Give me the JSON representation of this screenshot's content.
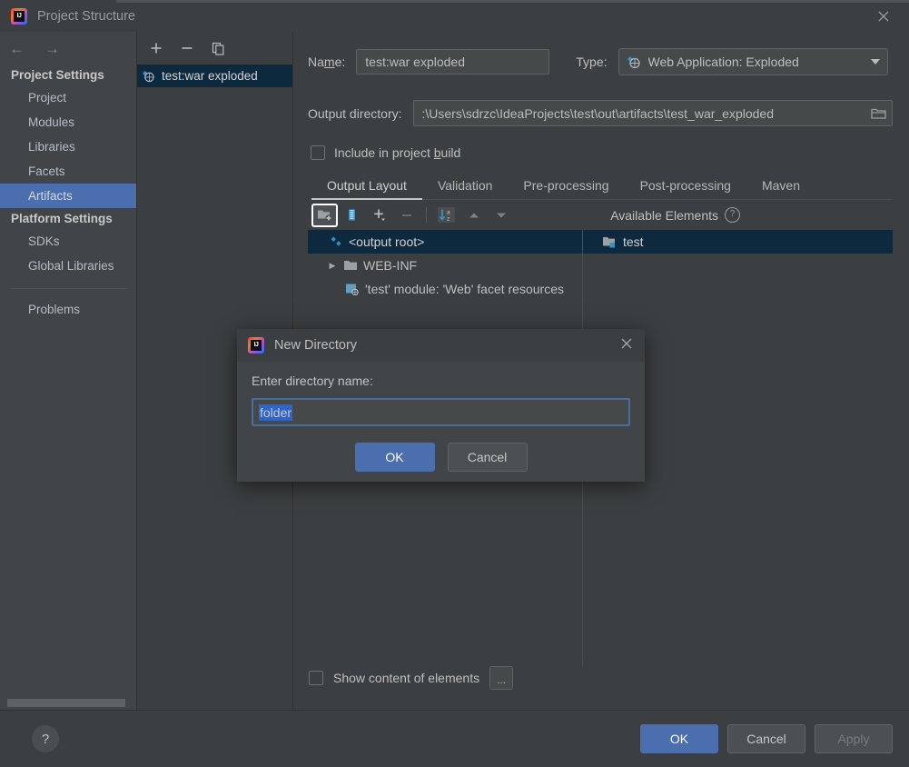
{
  "window": {
    "title": "Project Structure",
    "close_icon": "close-icon"
  },
  "sidebar": {
    "back_icon": "←",
    "forward_icon": "→",
    "groups": [
      {
        "label": "Project Settings",
        "items": [
          {
            "label": "Project",
            "selected": false
          },
          {
            "label": "Modules",
            "selected": false
          },
          {
            "label": "Libraries",
            "selected": false
          },
          {
            "label": "Facets",
            "selected": false
          },
          {
            "label": "Artifacts",
            "selected": true
          }
        ]
      },
      {
        "label": "Platform Settings",
        "items": [
          {
            "label": "SDKs",
            "selected": false
          },
          {
            "label": "Global Libraries",
            "selected": false
          }
        ]
      }
    ],
    "problems_label": "Problems"
  },
  "artifact_pane": {
    "toolbar": {
      "add_label": "+",
      "remove_label": "−",
      "copy_label": "copy-icon"
    },
    "items": [
      {
        "label": "test:war exploded",
        "selected": true
      }
    ]
  },
  "detail": {
    "name_label": "Na",
    "name_label_mnemonic": "m",
    "name_label_tail": "e:",
    "name_value": "test:war exploded",
    "type_label": "Type:",
    "type_value": "Web Application: Exploded",
    "output_dir_label": "Output directory:",
    "output_dir_value": ":\\Users\\sdrzc\\IdeaProjects\\test\\out\\artifacts\\test_war_exploded",
    "include_build_label_a": "Include in project ",
    "include_build_mnemonic": "b",
    "include_build_label_b": "uild",
    "include_build_checked": false,
    "tabs": [
      {
        "label": "Output Layout",
        "active": true
      },
      {
        "label": "Validation",
        "active": false
      },
      {
        "label": "Pre-processing",
        "active": false
      },
      {
        "label": "Post-processing",
        "active": false
      },
      {
        "label": "Maven",
        "active": false
      }
    ],
    "element_toolbar": {
      "new_directory_icon": "new-folder-icon",
      "new_archive_icon": "new-archive-icon",
      "add_icon": "+",
      "remove_icon": "−",
      "sort_icon": "sort-az-icon",
      "move_up_icon": "▲",
      "move_down_icon": "▼"
    },
    "available_elements_label": "Available Elements",
    "available_elements_help": "?",
    "output_tree": [
      {
        "label": "<output root>",
        "icon": "artifact-icon",
        "indent": 0,
        "expander": "",
        "selected": true
      },
      {
        "label": "WEB-INF",
        "icon": "folder-icon",
        "indent": 1,
        "expander": "▶",
        "selected": false
      },
      {
        "label": "'test' module: 'Web' facet resources",
        "icon": "facet-icon",
        "indent": 2,
        "expander": "",
        "selected": false
      }
    ],
    "available_tree": [
      {
        "label": "test",
        "icon": "module-folder-icon",
        "indent": 1,
        "selected": true
      }
    ],
    "show_content_label": "Show content of elements",
    "show_content_checked": false,
    "dots_button_label": "..."
  },
  "footer": {
    "help_label": "?",
    "ok_label": "OK",
    "cancel_label": "Cancel",
    "apply_label": "Apply"
  },
  "modal": {
    "title": "New Directory",
    "close_icon": "close-icon",
    "prompt": "Enter directory name:",
    "input_value": "folder",
    "ok_label": "OK",
    "cancel_label": "Cancel"
  }
}
